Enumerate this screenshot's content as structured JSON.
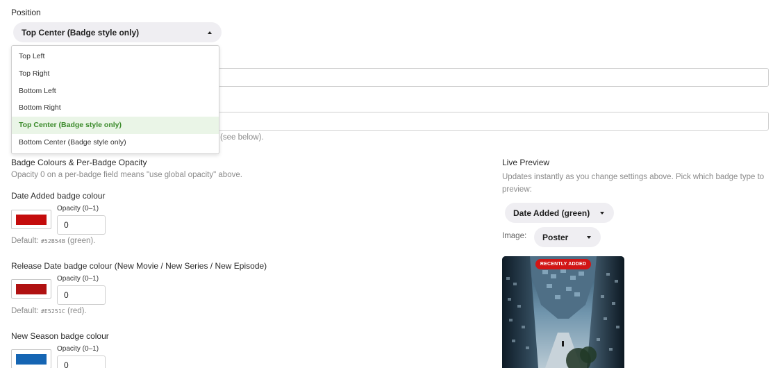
{
  "position": {
    "label": "Position",
    "selected": "Top Center (Badge style only)",
    "options": [
      "Top Left",
      "Top Right",
      "Bottom Left",
      "Bottom Right",
      "Top Center (Badge style only)",
      "Bottom Center (Badge style only)"
    ],
    "selected_index": 4
  },
  "hidden_help_tail": "(see below).",
  "badge_colours": {
    "heading": "Badge Colours & Per-Badge Opacity",
    "help": "Opacity 0 on a per-badge field means \"use global opacity\" above.",
    "items": [
      {
        "label": "Date Added badge colour",
        "color": "#c40c0c",
        "opacity_label": "Opacity (0–1)",
        "opacity_value": "0",
        "default_prefix": "Default:",
        "default_code": "#52B54B",
        "default_suffix": "(green)."
      },
      {
        "label": "Release Date badge colour (New Movie / New Series / New Episode)",
        "color": "#b01111",
        "opacity_label": "Opacity (0–1)",
        "opacity_value": "0",
        "default_prefix": "Default:",
        "default_code": "#E5251C",
        "default_suffix": "(red)."
      },
      {
        "label": "New Season badge colour",
        "color": "#1565b3",
        "opacity_label": "Opacity (0–1)",
        "opacity_value": "0"
      }
    ]
  },
  "live_preview": {
    "heading": "Live Preview",
    "help": "Updates instantly as you change settings above. Pick which badge type to preview:",
    "badge_type_selected": "Date Added (green)",
    "image_label": "Image:",
    "image_selected": "Poster",
    "badge_text": "RECENTLY ADDED"
  },
  "colors": {
    "selected_option_bg": "#eaf5e7",
    "selected_option_text": "#3a8a2a",
    "select_bg": "#efeef2"
  }
}
